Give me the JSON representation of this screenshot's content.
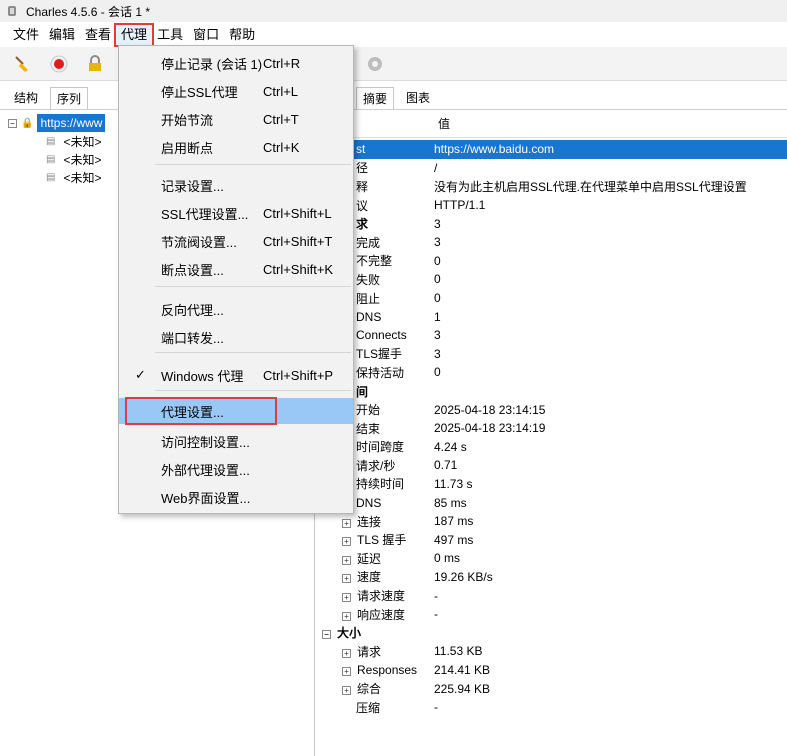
{
  "window": {
    "title": "Charles 4.5.6 - 会话 1 *"
  },
  "menubar": [
    "文件",
    "编辑",
    "查看",
    "代理",
    "工具",
    "窗口",
    "帮助"
  ],
  "left": {
    "tabs": [
      "结构",
      "序列"
    ],
    "host": "https://www",
    "children": [
      "<未知>",
      "<未知>",
      "<未知>"
    ]
  },
  "right": {
    "tabs": [
      "摘要",
      "图表"
    ],
    "value_header": "值",
    "rows": [
      {
        "k": "st",
        "v": "https://www.baidu.com",
        "sel": true
      },
      {
        "k": "径",
        "v": "/"
      },
      {
        "k": "释",
        "v": "没有为此主机启用SSL代理.在代理菜单中启用SSL代理设置"
      },
      {
        "k": "议",
        "v": "HTTP/1.1"
      },
      {
        "k": "求",
        "v": "3",
        "bold": true
      },
      {
        "k": "完成",
        "v": "3"
      },
      {
        "k": "不完整",
        "v": "0"
      },
      {
        "k": "失败",
        "v": "0"
      },
      {
        "k": "阻止",
        "v": "0"
      },
      {
        "k": "DNS",
        "v": "1"
      },
      {
        "k": "Connects",
        "v": "3"
      },
      {
        "k": "TLS握手",
        "v": "3"
      },
      {
        "k": "保持活动",
        "v": "0"
      },
      {
        "k": "间",
        "v": "",
        "bold": true
      },
      {
        "k": "开始",
        "v": "2025-04-18 23:14:15"
      },
      {
        "k": "结束",
        "v": "2025-04-18 23:14:19"
      },
      {
        "k": "时间跨度",
        "v": "4.24 s"
      },
      {
        "k": "请求/秒",
        "v": "0.71"
      },
      {
        "k": "持续时间",
        "v": "11.73 s"
      },
      {
        "k": "DNS",
        "v": "85 ms"
      },
      {
        "k": "连接",
        "v": "187 ms",
        "plus": true
      },
      {
        "k": "TLS 握手",
        "v": "497 ms",
        "plus": true
      },
      {
        "k": "延迟",
        "v": "0 ms",
        "plus": true
      },
      {
        "k": "速度",
        "v": "19.26 KB/s",
        "plus": true
      },
      {
        "k": "请求速度",
        "v": "-",
        "plus": true
      },
      {
        "k": "响应速度",
        "v": "-",
        "plus": true
      },
      {
        "k": "大小",
        "v": "",
        "bold": true,
        "minus": true
      },
      {
        "k": "请求",
        "v": "11.53 KB",
        "plus": true
      },
      {
        "k": "Responses",
        "v": "214.41 KB",
        "plus": true
      },
      {
        "k": "综合",
        "v": "225.94 KB",
        "plus": true
      },
      {
        "k": "压缩",
        "v": "-"
      }
    ]
  },
  "proxy_menu": {
    "items": [
      {
        "label": "停止记录 (会话 1)",
        "shortcut": "Ctrl+R"
      },
      {
        "label": "停止SSL代理",
        "shortcut": "Ctrl+L"
      },
      {
        "label": "开始节流",
        "shortcut": "Ctrl+T"
      },
      {
        "label": "启用断点",
        "shortcut": "Ctrl+K"
      },
      {
        "label": "记录设置...",
        "shortcut": ""
      },
      {
        "label": "SSL代理设置...",
        "shortcut": "Ctrl+Shift+L"
      },
      {
        "label": "节流阀设置...",
        "shortcut": "Ctrl+Shift+T"
      },
      {
        "label": "断点设置...",
        "shortcut": "Ctrl+Shift+K"
      },
      {
        "label": "反向代理...",
        "shortcut": ""
      },
      {
        "label": "端口转发...",
        "shortcut": ""
      },
      {
        "label": "Windows 代理",
        "shortcut": "Ctrl+Shift+P",
        "checked": true
      },
      {
        "label": "代理设置...",
        "shortcut": "",
        "highlighted": true
      },
      {
        "label": "访问控制设置...",
        "shortcut": ""
      },
      {
        "label": "外部代理设置...",
        "shortcut": ""
      },
      {
        "label": "Web界面设置...",
        "shortcut": ""
      }
    ],
    "checkmark": "✓"
  }
}
